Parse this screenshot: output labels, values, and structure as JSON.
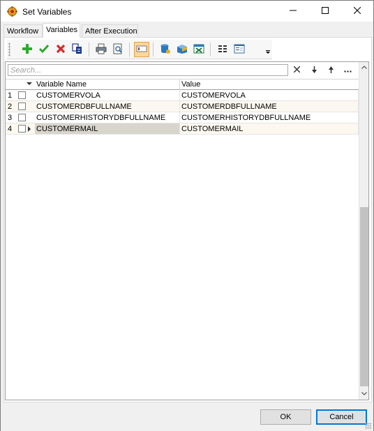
{
  "window": {
    "title": "Set Variables",
    "icons": {
      "app": "gear-app-icon",
      "minimize": "minimize-icon",
      "maximize": "maximize-icon",
      "close": "close-icon"
    }
  },
  "tabs": [
    {
      "label": "Workflow",
      "active": false
    },
    {
      "label": "Variables",
      "active": true
    },
    {
      "label": "After Execution",
      "active": false
    }
  ],
  "toolbar": {
    "buttons": [
      {
        "name": "add-icon",
        "color": "#2ea82e"
      },
      {
        "name": "check-icon",
        "color": "#2ea82e"
      },
      {
        "name": "delete-icon",
        "color": "#d62828"
      },
      {
        "name": "copy-icon",
        "color": "#1a3a8a"
      },
      {
        "name": "print-icon",
        "color": "#555555"
      },
      {
        "name": "print-preview-icon",
        "color": "#555555"
      },
      {
        "name": "toggle-field-icon",
        "color": "#e1a049",
        "checked": true
      },
      {
        "name": "database-export-icon",
        "color": "#2b78c2"
      },
      {
        "name": "box-import-icon",
        "color": "#2b78c2"
      },
      {
        "name": "excel-export-icon",
        "color": "#1f7a3a"
      },
      {
        "name": "columns-icon",
        "color": "#333333"
      },
      {
        "name": "form-view-icon",
        "color": "#3a6ea5"
      }
    ]
  },
  "search": {
    "placeholder": "Search...",
    "value": "",
    "actions": [
      "clear-icon",
      "arrow-down-icon",
      "arrow-up-icon",
      "more-icon"
    ]
  },
  "grid": {
    "columns": [
      "Variable Name",
      "Value"
    ],
    "rows": [
      {
        "num": "1",
        "name": "CUSTOMERVOLA",
        "value": "CUSTOMERVOLA",
        "checked": false,
        "current": false
      },
      {
        "num": "2",
        "name": "CUSTOMERDBFULLNAME",
        "value": "CUSTOMERDBFULLNAME",
        "checked": false,
        "current": false
      },
      {
        "num": "3",
        "name": "CUSTOMERHISTORYDBFULLNAME",
        "value": "CUSTOMERHISTORYDBFULLNAME",
        "checked": false,
        "current": false
      },
      {
        "num": "4",
        "name": "CUSTOMERMAIL",
        "value": "CUSTOMERMAIL",
        "checked": false,
        "current": true
      }
    ],
    "colors": {
      "alt_row": "#fcf8ef",
      "selected_cell": "#d8d5cc"
    }
  },
  "footer": {
    "ok_label": "OK",
    "cancel_label": "Cancel"
  }
}
